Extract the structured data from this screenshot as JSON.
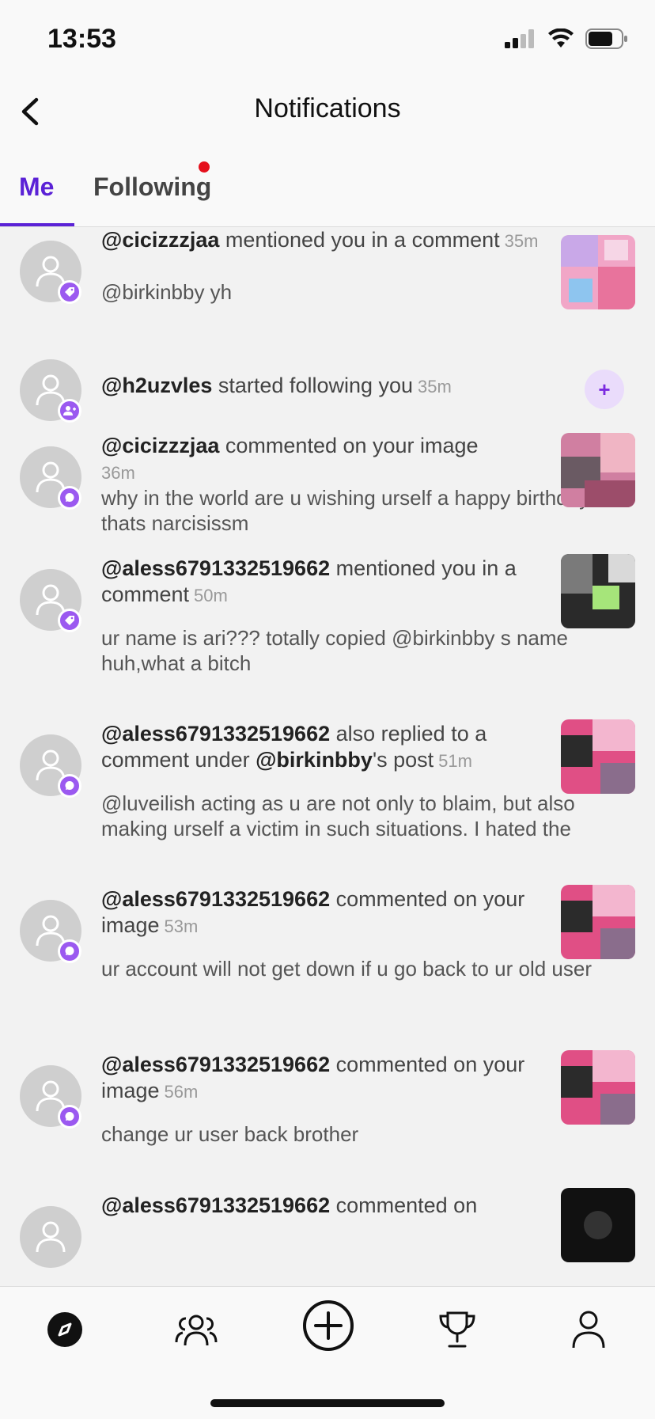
{
  "status": {
    "time": "13:53"
  },
  "header": {
    "title": "Notifications"
  },
  "tabs": [
    {
      "label": "Me"
    },
    {
      "label": "Following"
    }
  ],
  "notifications": [
    {
      "user": "@cicizzzjaa",
      "action": " mentioned you in a comment",
      "time": "35m",
      "comment": "@birkinbby yh",
      "badge": "tag-icon",
      "thumb_colors": [
        "#f1a6c7",
        "#c9a8e8",
        "#e8739c",
        "#8ec5ef"
      ]
    },
    {
      "user": "@h2uzvles",
      "action": " started following you",
      "time": "35m",
      "badge": "add-user-icon",
      "follow_label": "+"
    },
    {
      "user": "@cicizzzjaa",
      "action": " commented on your image",
      "time": "36m",
      "comment": "why in the world are u wishing urself a happy birthday thats narcisissm",
      "badge": "chat-icon",
      "thumb_colors": [
        "#d07fa1",
        "#6a5a63",
        "#f0b5c4",
        "#9c4d6a"
      ]
    },
    {
      "user": "@aless6791332519662",
      "action": " mentioned you in a comment",
      "time": "50m",
      "comment": "ur name is ari??? totally copied @birkinbby s name huh,what a bitch",
      "badge": "tag-icon",
      "thumb_colors": [
        "#2a2a2a",
        "#7a7a7a",
        "#a6e57a",
        "#d9d9d9"
      ]
    },
    {
      "user": "@aless6791332519662",
      "action_part1": " also replied to a comment under ",
      "mention": "@birkinbby",
      "action_part2": "'s post",
      "time": "51m",
      "comment": "@luveilish acting as u are not only to blaim, but also making urself a victim in such situations. I hated the",
      "badge": "chat-icon",
      "thumb_colors": [
        "#e04f85",
        "#2b2b2b",
        "#f3b6cf",
        "#8a6d8c"
      ]
    },
    {
      "user": "@aless6791332519662",
      "action": " commented on your image",
      "time": "53m",
      "comment": "ur account will not get down if u go back to ur old user",
      "badge": "chat-icon",
      "thumb_colors": [
        "#e04f85",
        "#2b2b2b",
        "#f3b6cf",
        "#8a6d8c"
      ]
    },
    {
      "user": "@aless6791332519662",
      "action": " commented on your image",
      "time": "56m",
      "comment": "change ur user back brother",
      "badge": "chat-icon",
      "thumb_colors": [
        "#e04f85",
        "#2b2b2b",
        "#f3b6cf",
        "#8a6d8c"
      ]
    },
    {
      "user": "@aless6791332519662",
      "action": " commented on",
      "time": "",
      "badge": "chat-icon",
      "thumb_colors": [
        "#111111",
        "#333333",
        "#555555",
        "#111111"
      ]
    }
  ],
  "tabbar": [
    {
      "icon": "compass-icon",
      "active": true
    },
    {
      "icon": "community-icon"
    },
    {
      "icon": "plus-circle-icon"
    },
    {
      "icon": "trophy-icon"
    },
    {
      "icon": "profile-icon"
    }
  ],
  "colors": {
    "accent": "#5b22d6",
    "badge": "#9b59f0",
    "dot": "#e5101c"
  }
}
